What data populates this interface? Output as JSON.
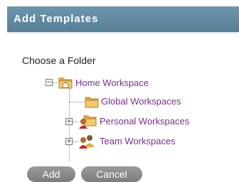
{
  "header": {
    "title": "Add Templates"
  },
  "folder_label": "Choose a Folder",
  "tree": {
    "root": {
      "label": "Home Workspace",
      "toggle": "−",
      "icon": "folder-home-icon"
    },
    "children": [
      {
        "label": "Global Workspaces",
        "toggle": "",
        "icon": "folder-globe-icon"
      },
      {
        "label": "Personal Workspaces",
        "toggle": "+",
        "icon": "folder-person-icon"
      },
      {
        "label": "Team Workspaces",
        "toggle": "+",
        "icon": "team-icon"
      }
    ]
  },
  "buttons": {
    "add": "Add",
    "cancel": "Cancel"
  }
}
